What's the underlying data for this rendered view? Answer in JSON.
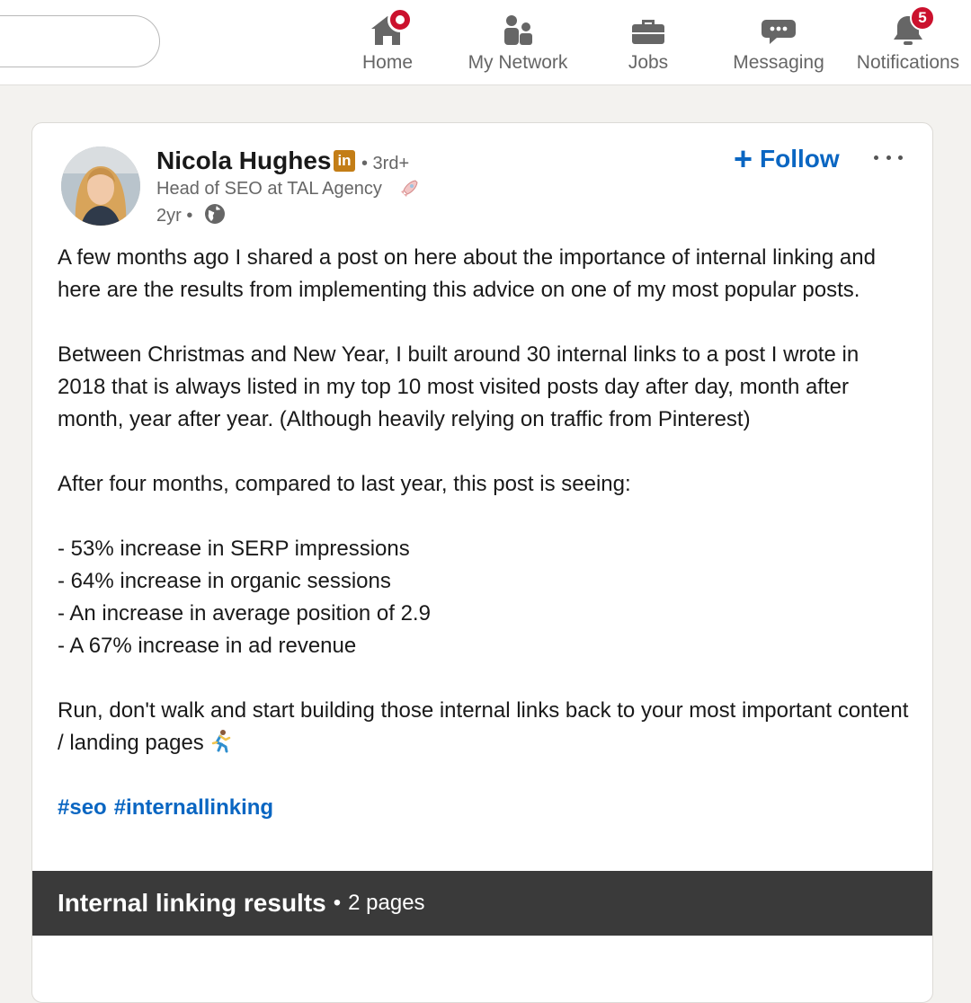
{
  "nav": {
    "items": [
      {
        "label": "Home",
        "icon": "home-icon",
        "badge": ""
      },
      {
        "label": "My Network",
        "icon": "network-icon",
        "badge": ""
      },
      {
        "label": "Jobs",
        "icon": "briefcase-icon",
        "badge": ""
      },
      {
        "label": "Messaging",
        "icon": "chat-icon",
        "badge": ""
      },
      {
        "label": "Notifications",
        "icon": "bell-icon",
        "badge": "5"
      }
    ]
  },
  "post": {
    "author": {
      "name": "Nicola Hughes",
      "degree": "• 3rd+",
      "headline": "Head of SEO at TAL Agency",
      "time": "2yr •"
    },
    "follow_label": "Follow",
    "body": {
      "p1": "A few months ago I shared a post on here about the importance of internal linking and here are the results from implementing this advice on one of my most popular posts.",
      "p2": "Between Christmas and New Year, I built around 30 internal links to a post I wrote in 2018 that is always listed in my top 10 most visited posts day after day, month after month, year after year. (Although heavily relying on traffic from Pinterest)",
      "p3": "After four months, compared to last year, this post is seeing:",
      "bullets": [
        "- 53% increase in SERP impressions",
        "- 64% increase in organic sessions",
        "- An increase in average position of 2.9",
        "- A 67% increase in ad revenue"
      ],
      "p4": "Run, don't walk and start building those internal links back to your most important content / landing pages"
    },
    "hashtags": [
      "#seo",
      "#internallinking"
    ],
    "document": {
      "title": "Internal linking results",
      "separator": "•",
      "pages": "2 pages"
    }
  },
  "colors": {
    "accent": "#0a66c2",
    "badge": "#cb112d",
    "nav_icon": "#666666",
    "doc_header": "#3a3a3a"
  }
}
